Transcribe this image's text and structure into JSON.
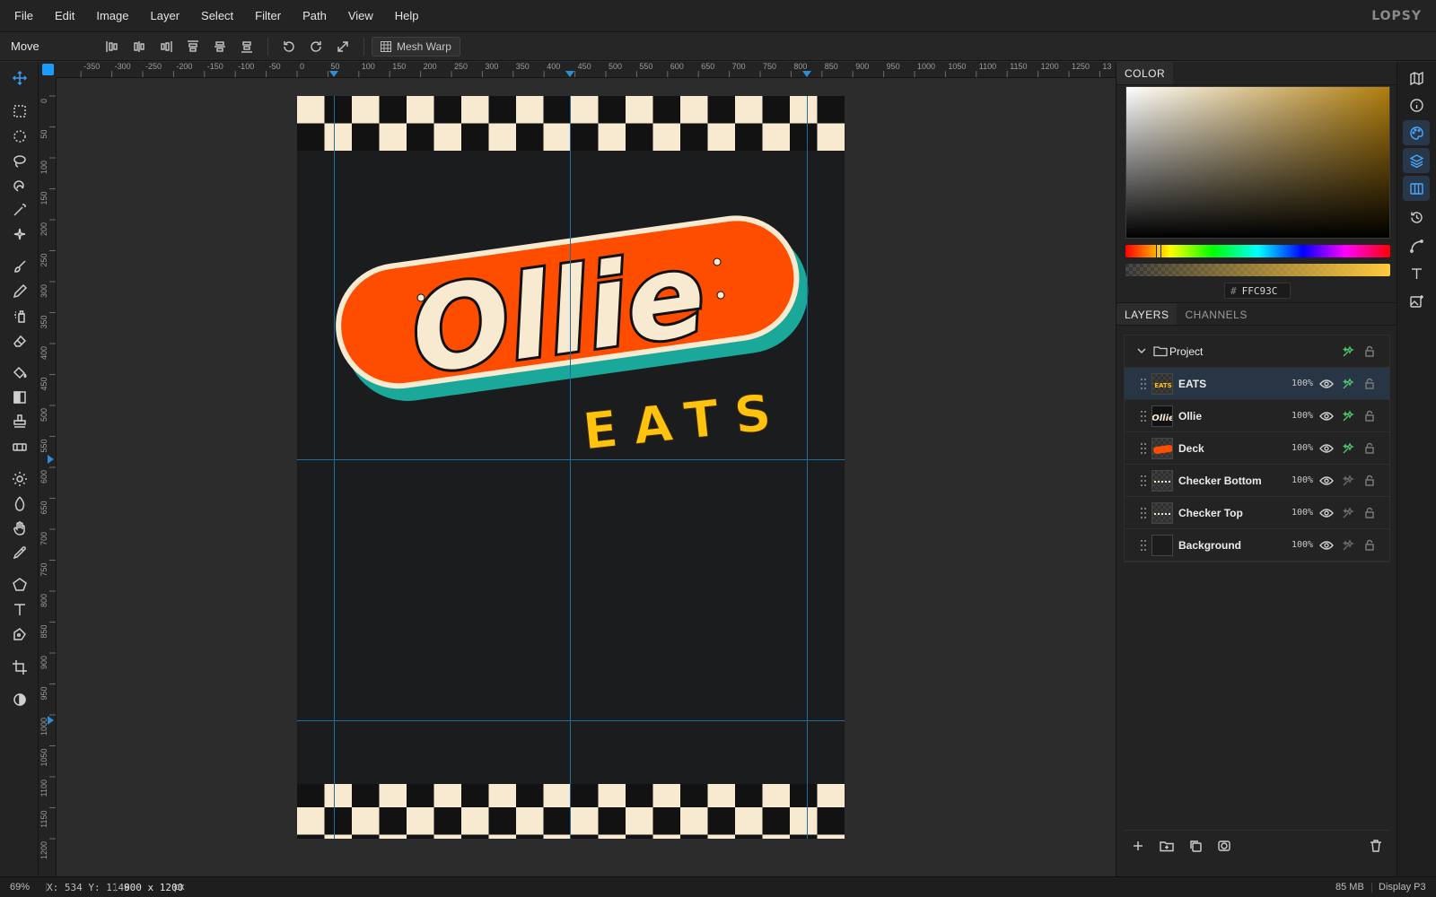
{
  "app": {
    "logo": "LOPSY"
  },
  "menu": [
    "File",
    "Edit",
    "Image",
    "Layer",
    "Select",
    "Filter",
    "Path",
    "View",
    "Help"
  ],
  "options_bar": {
    "tool_name": "Move",
    "mesh_warp_label": "Mesh Warp"
  },
  "rulers": {
    "top": [
      "-350",
      "-300",
      "-250",
      "-200",
      "-150",
      "-100",
      "-50",
      "0",
      "50",
      "100",
      "150",
      "200",
      "250",
      "300",
      "350",
      "400",
      "450",
      "500",
      "550",
      "600",
      "650",
      "700",
      "750",
      "800",
      "850",
      "900",
      "950",
      "1000",
      "1050",
      "1100",
      "1150",
      "1200",
      "1250",
      "13"
    ],
    "left": [
      "0",
      "50",
      "100",
      "150",
      "200",
      "250",
      "300",
      "350",
      "400",
      "450",
      "500",
      "550",
      "600",
      "650",
      "700",
      "750",
      "800",
      "850",
      "900",
      "950",
      "1000",
      "1050",
      "1100",
      "1150",
      "1200"
    ]
  },
  "artwork": {
    "logo_word": "Ollie",
    "sub_word": "EATS",
    "colors": {
      "deck": "#ff4d00",
      "deck_shadow": "#1aa89b",
      "cream": "#f7ead0",
      "eats": "#ffc20e",
      "background": "#1b1c1e"
    }
  },
  "color_panel": {
    "tab": "COLOR",
    "hex_value": "FFC93C",
    "hash": "#"
  },
  "layers_panel": {
    "tabs": [
      "LAYERS",
      "CHANNELS"
    ],
    "group": "Project",
    "layers": [
      {
        "name": "EATS",
        "opacity": "100%"
      },
      {
        "name": "Ollie",
        "opacity": "100%"
      },
      {
        "name": "Deck",
        "opacity": "100%"
      },
      {
        "name": "Checker Bottom",
        "opacity": "100%"
      },
      {
        "name": "Checker Top",
        "opacity": "100%"
      },
      {
        "name": "Background",
        "opacity": "100%"
      }
    ]
  },
  "status": {
    "zoom": "69%",
    "xy_label": "X: 534  Y: 1148",
    "doc_size": "900 x 1200",
    "doc_unit": "px",
    "memory": "85 MB",
    "color_profile": "Display P3"
  }
}
